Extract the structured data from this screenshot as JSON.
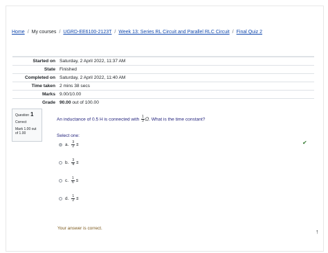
{
  "breadcrumb": {
    "home": "Home",
    "my_courses": "My courses",
    "course": "UGRD-EE6100-2123T",
    "week": "Week 13: Series RL Circuit and Parallel RLC Circuit",
    "quiz": "Final Quiz 2",
    "separator": "/"
  },
  "summary": {
    "rows": [
      {
        "label": "Started on",
        "value": "Saturday, 2 April 2022, 11:37 AM"
      },
      {
        "label": "State",
        "value": "Finished"
      },
      {
        "label": "Completed on",
        "value": "Saturday, 2 April 2022, 11:40 AM"
      },
      {
        "label": "Time taken",
        "value": "2 mins 38 secs"
      },
      {
        "label": "Marks",
        "value": "9.00/10.00"
      },
      {
        "label": "Grade",
        "value_bold": "90.00",
        "value_rest": "out of 100.00"
      }
    ]
  },
  "question": {
    "label": "Question",
    "number": "1",
    "state": "Correct",
    "mark": "Mark 1.00 out of 1.00",
    "text_before": "An inductance of 0.5 H is connected with",
    "frac_num": "1",
    "frac_den": "3",
    "omega": "Ω",
    "text_after": ". What is the time constant?",
    "select_one": "Select one:",
    "options": [
      {
        "letter": "a.",
        "num": "3",
        "den": "2",
        "unit": "s"
      },
      {
        "letter": "b.",
        "num": "3",
        "den": "4",
        "unit": "s"
      },
      {
        "letter": "c.",
        "num": "1",
        "den": "6",
        "unit": "s"
      },
      {
        "letter": "d.",
        "num": "1",
        "den": "2",
        "unit": "s"
      }
    ],
    "feedback": "Your answer is correct.",
    "correct_mark": "✔"
  },
  "to_top": "↑"
}
